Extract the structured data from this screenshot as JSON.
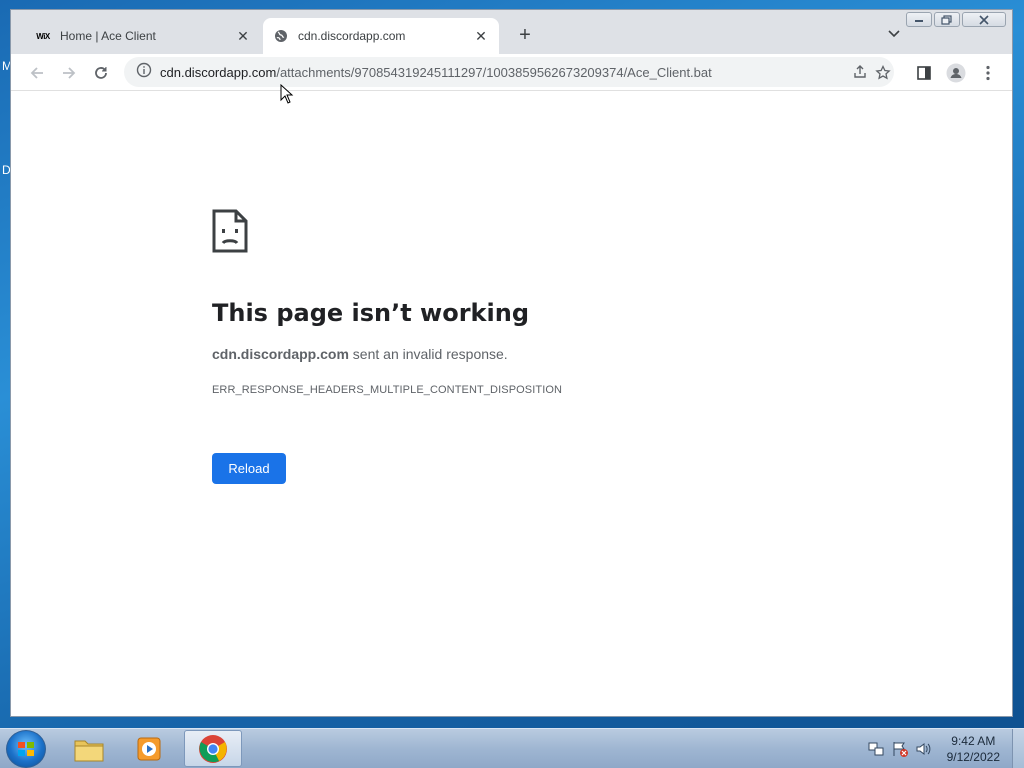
{
  "desktop": {
    "edge_label_1": "M",
    "edge_label_2": "D"
  },
  "tabs": [
    {
      "title": "Home | Ace Client",
      "favicon": "wix-icon",
      "favicon_text": "WiX",
      "active": false
    },
    {
      "title": "cdn.discordapp.com",
      "favicon": "globe-icon",
      "active": true
    }
  ],
  "address_bar": {
    "host": "cdn.discordapp.com",
    "path": "/attachments/970854319245111297/1003859562673209374/Ace_Client.bat"
  },
  "error_page": {
    "title": "This page isn’t working",
    "host": "cdn.discordapp.com",
    "message": " sent an invalid response.",
    "code": "ERR_RESPONSE_HEADERS_MULTIPLE_CONTENT_DISPOSITION",
    "reload_label": "Reload"
  },
  "taskbar": {
    "items": [
      "start-button",
      "file-explorer",
      "media-player",
      "chrome"
    ],
    "clock_time": "9:42 AM",
    "clock_date": "9/12/2022"
  },
  "colors": {
    "accent": "#1a73e8",
    "title_bar": "#dee1e6"
  }
}
